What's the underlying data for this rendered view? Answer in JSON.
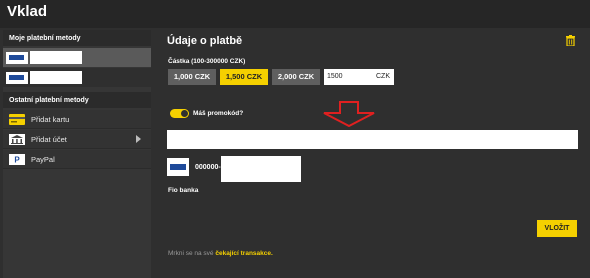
{
  "header": {
    "title": "Vklad"
  },
  "sidebar": {
    "my_methods_title": "Moje platební metody",
    "other_methods_title": "Ostatní platební metody",
    "other_methods": [
      {
        "label": "Přidat kartu",
        "icon": "card-icon"
      },
      {
        "label": "Přidat účet",
        "icon": "bank-icon"
      },
      {
        "label": "PayPal",
        "icon": "paypal-icon"
      }
    ]
  },
  "main": {
    "title": "Údaje o platbě",
    "amount_label": "Částka (100-300000 CZK)",
    "amount_options": [
      "1,000 CZK",
      "1,500 CZK",
      "2,000 CZK"
    ],
    "selected_amount_index": 1,
    "amount_value": "1500",
    "amount_currency": "CZK",
    "promo_label": "Máš promokód?",
    "promo_enabled": true,
    "promo_value": "",
    "account_number_prefix": "000000-",
    "bank_name": "Fio banka",
    "submit_label": "VLOŽIT",
    "note_text": "Mrkni se na své",
    "note_link": "čekající transakce."
  },
  "colors": {
    "accent": "#f5d000",
    "background": "#2f2f2f",
    "arrow": "#e02020"
  }
}
